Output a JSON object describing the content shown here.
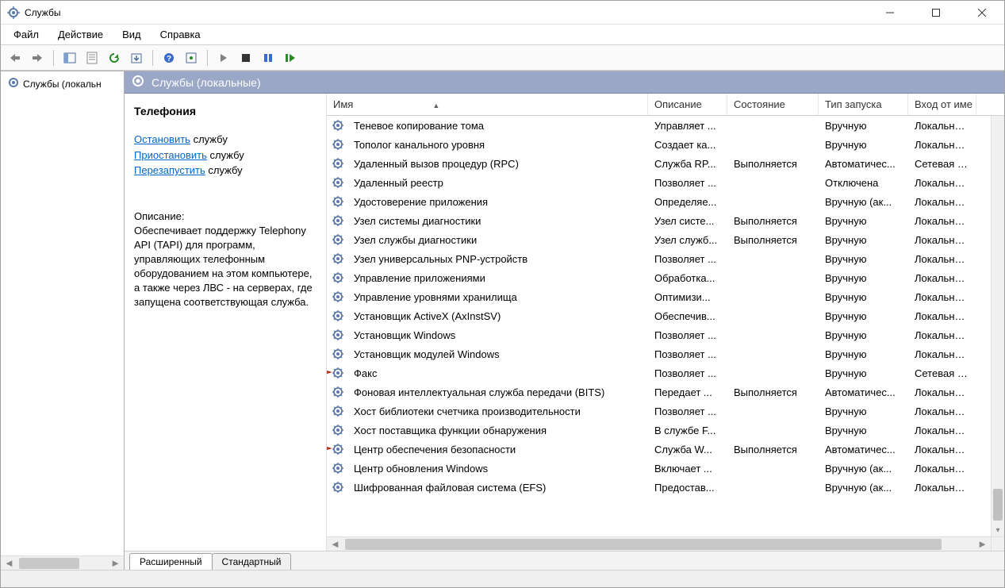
{
  "window": {
    "title": "Службы"
  },
  "menu": [
    "Файл",
    "Действие",
    "Вид",
    "Справка"
  ],
  "tree": {
    "root": "Службы (локальн"
  },
  "content_header": "Службы (локальные)",
  "detail": {
    "title": "Телефония",
    "links": [
      {
        "action": "Остановить",
        "suffix": " службу"
      },
      {
        "action": "Приостановить",
        "suffix": " службу"
      },
      {
        "action": "Перезапустить",
        "suffix": " службу"
      }
    ],
    "desc_label": "Описание:",
    "desc": "Обеспечивает поддержку Telephony API (TAPI) для программ, управляющих телефонным оборудованием на этом компьютере, а также через ЛВС - на серверах, где запущена соответствующая служба."
  },
  "columns": [
    "Имя",
    "Описание",
    "Состояние",
    "Тип запуска",
    "Вход от име"
  ],
  "services": [
    {
      "name": "Теневое копирование тома",
      "desc": "Управляет ...",
      "state": "",
      "start": "Вручную",
      "logon": "Локальная с"
    },
    {
      "name": "Тополог канального уровня",
      "desc": "Создает ка...",
      "state": "",
      "start": "Вручную",
      "logon": "Локальная с"
    },
    {
      "name": "Удаленный вызов процедур (RPC)",
      "desc": "Служба RP...",
      "state": "Выполняется",
      "start": "Автоматичес...",
      "logon": "Сетевая слу"
    },
    {
      "name": "Удаленный реестр",
      "desc": "Позволяет ...",
      "state": "",
      "start": "Отключена",
      "logon": "Локальная с"
    },
    {
      "name": "Удостоверение приложения",
      "desc": "Определяе...",
      "state": "",
      "start": "Вручную (ак...",
      "logon": "Локальная с"
    },
    {
      "name": "Узел системы диагностики",
      "desc": "Узел систе...",
      "state": "Выполняется",
      "start": "Вручную",
      "logon": "Локальная с"
    },
    {
      "name": "Узел службы диагностики",
      "desc": "Узел служб...",
      "state": "Выполняется",
      "start": "Вручную",
      "logon": "Локальная с"
    },
    {
      "name": "Узел универсальных PNP-устройств",
      "desc": "Позволяет ...",
      "state": "",
      "start": "Вручную",
      "logon": "Локальная с"
    },
    {
      "name": "Управление приложениями",
      "desc": "Обработка...",
      "state": "",
      "start": "Вручную",
      "logon": "Локальная с"
    },
    {
      "name": "Управление уровнями хранилища",
      "desc": "Оптимизи...",
      "state": "",
      "start": "Вручную",
      "logon": "Локальная с"
    },
    {
      "name": "Установщик ActiveX (AxInstSV)",
      "desc": "Обеспечив...",
      "state": "",
      "start": "Вручную",
      "logon": "Локальная с"
    },
    {
      "name": "Установщик Windows",
      "desc": "Позволяет ...",
      "state": "",
      "start": "Вручную",
      "logon": "Локальная с"
    },
    {
      "name": "Установщик модулей Windows",
      "desc": "Позволяет ...",
      "state": "",
      "start": "Вручную",
      "logon": "Локальная с"
    },
    {
      "name": "Факс",
      "desc": "Позволяет ...",
      "state": "",
      "start": "Вручную",
      "logon": "Сетевая слу"
    },
    {
      "name": "Фоновая интеллектуальная служба передачи (BITS)",
      "desc": "Передает ...",
      "state": "Выполняется",
      "start": "Автоматичес...",
      "logon": "Локальная с"
    },
    {
      "name": "Хост библиотеки счетчика производительности",
      "desc": "Позволяет ...",
      "state": "",
      "start": "Вручную",
      "logon": "Локальная с"
    },
    {
      "name": "Хост поставщика функции обнаружения",
      "desc": "В службе F...",
      "state": "",
      "start": "Вручную",
      "logon": "Локальная с"
    },
    {
      "name": "Центр обеспечения безопасности",
      "desc": "Служба W...",
      "state": "Выполняется",
      "start": "Автоматичес...",
      "logon": "Локальная с"
    },
    {
      "name": "Центр обновления Windows",
      "desc": "Включает ...",
      "state": "",
      "start": "Вручную (ак...",
      "logon": "Локальная с"
    },
    {
      "name": "Шифрованная файловая система (EFS)",
      "desc": "Предостав...",
      "state": "",
      "start": "Вручную (ак...",
      "logon": "Локальная с"
    }
  ],
  "tabs": [
    "Расширенный",
    "Стандартный"
  ]
}
